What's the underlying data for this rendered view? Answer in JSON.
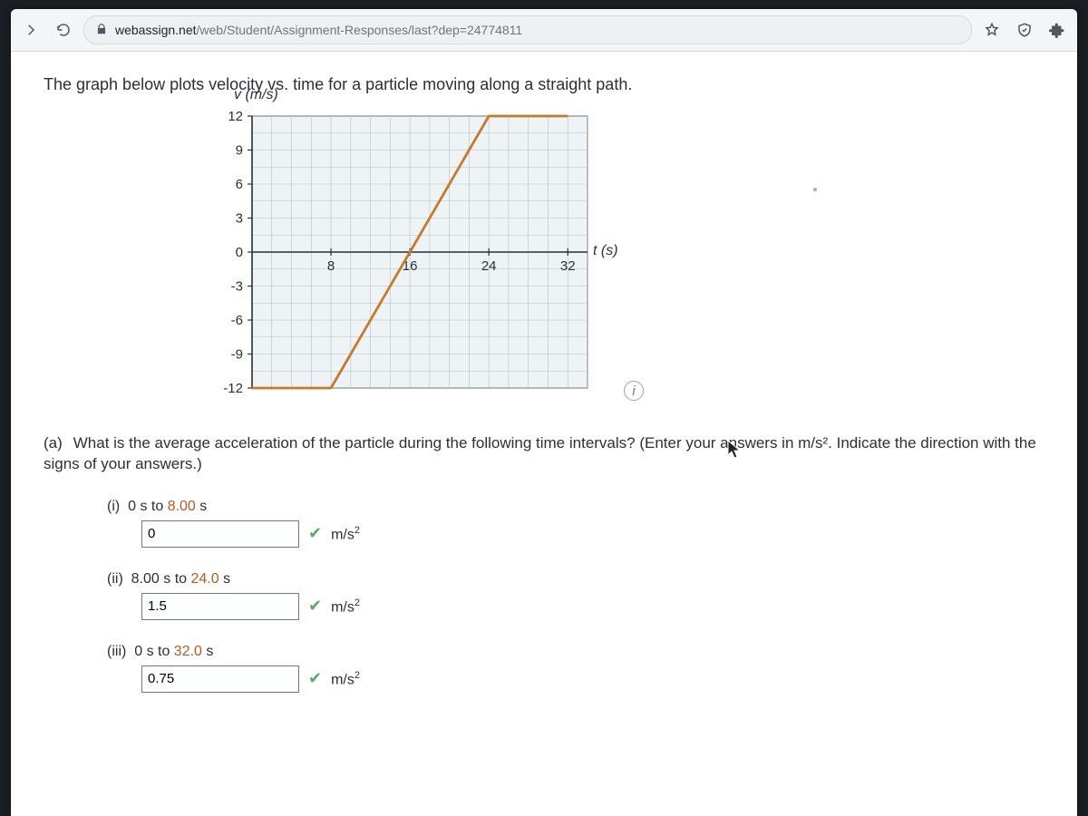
{
  "browser": {
    "url_domain": "webassign.net",
    "url_path": "/web/Student/Assignment-Responses/last?dep=24774811"
  },
  "page": {
    "intro": "The graph below plots velocity vs. time for a particle moving along a straight path.",
    "y_axis_label": "v (m/s)",
    "x_axis_label": "t (s)",
    "question_label": "(a)",
    "question_text": "What is the average acceleration of the particle during the following time intervals? (Enter your answers in m/s². Indicate the direction with the signs of your answers.)",
    "subs": [
      {
        "roman": "(i)",
        "range_pre": "0 s to ",
        "range_hl": "8.00",
        "range_post": " s",
        "value": "0",
        "unit": "m/s²"
      },
      {
        "roman": "(ii)",
        "range_pre": "8.00 s to ",
        "range_hl": "24.0",
        "range_post": " s",
        "value": "1.5",
        "unit": "m/s²"
      },
      {
        "roman": "(iii)",
        "range_pre": "0 s to ",
        "range_hl": "32.0",
        "range_post": " s",
        "value": "0.75",
        "unit": "m/s²"
      }
    ]
  },
  "chart_data": {
    "type": "line",
    "title": "",
    "xlabel": "t (s)",
    "ylabel": "v (m/s)",
    "x_ticks": [
      8,
      16,
      24,
      32
    ],
    "y_ticks": [
      12,
      9,
      6,
      3,
      0,
      -3,
      -6,
      -9,
      -12
    ],
    "xlim": [
      0,
      34
    ],
    "ylim": [
      -12,
      12
    ],
    "x": [
      0,
      8,
      24,
      32
    ],
    "values": [
      -12,
      -12,
      12,
      12
    ],
    "colors": {
      "grid": "#b4c1ca",
      "axis": "#2b3034",
      "curve": "#c77a2d",
      "plot_bg": "#eef3f5"
    }
  }
}
